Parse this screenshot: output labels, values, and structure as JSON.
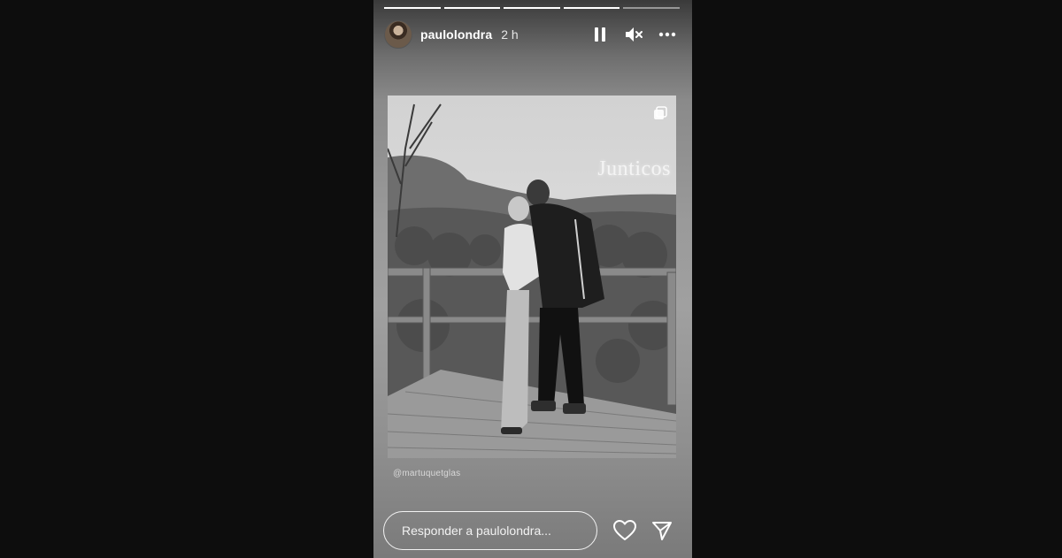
{
  "story": {
    "progress": [
      1,
      1,
      1,
      1,
      0
    ],
    "user": {
      "username": "paulolondra",
      "time_ago": "2 h",
      "avatar_icon": "user-avatar"
    },
    "controls": {
      "pause_icon": "pause-icon",
      "mute_icon": "muted-speaker-icon",
      "more_icon": "more-horizontal-icon"
    },
    "photo": {
      "overlay_text": "Junticos",
      "badge_icon": "multiple-posts-icon"
    },
    "mention": "@martuquetglas",
    "footer": {
      "reply_placeholder": "Responder a paulolondra...",
      "like_icon": "heart-icon",
      "share_icon": "send-icon"
    }
  },
  "colors": {
    "page_background": "#0d0d0d",
    "text": "#ffffff"
  }
}
